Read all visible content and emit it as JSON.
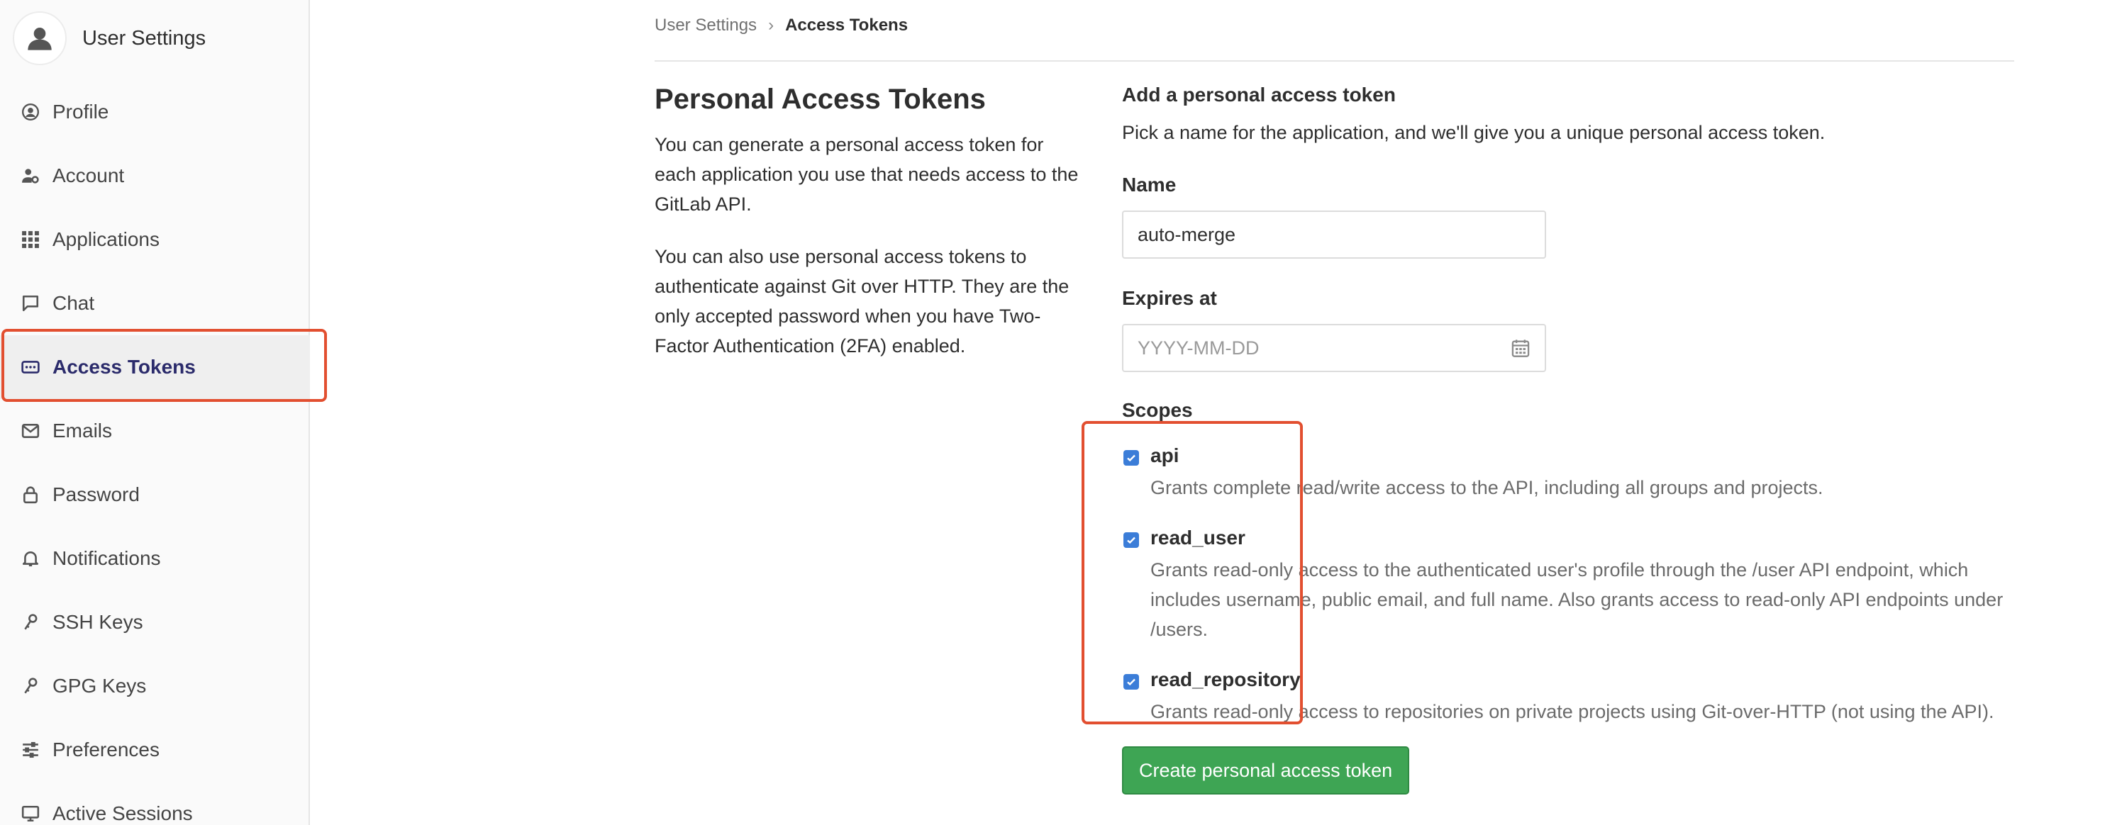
{
  "sidebar": {
    "title": "User Settings",
    "items": [
      {
        "label": "Profile",
        "icon": "user-circle-icon"
      },
      {
        "label": "Account",
        "icon": "account-gear-icon"
      },
      {
        "label": "Applications",
        "icon": "apps-grid-icon"
      },
      {
        "label": "Chat",
        "icon": "chat-bubble-icon"
      },
      {
        "label": "Access Tokens",
        "icon": "token-icon",
        "active": true
      },
      {
        "label": "Emails",
        "icon": "envelope-icon"
      },
      {
        "label": "Password",
        "icon": "lock-icon"
      },
      {
        "label": "Notifications",
        "icon": "bell-icon"
      },
      {
        "label": "SSH Keys",
        "icon": "key-icon"
      },
      {
        "label": "GPG Keys",
        "icon": "key-icon"
      },
      {
        "label": "Preferences",
        "icon": "sliders-icon"
      },
      {
        "label": "Active Sessions",
        "icon": "monitor-icon"
      }
    ]
  },
  "breadcrumb": {
    "parent": "User Settings",
    "separator": "›",
    "current": "Access Tokens"
  },
  "intro": {
    "title": "Personal Access Tokens",
    "p1": "You can generate a personal access token for each application you use that needs access to the GitLab API.",
    "p2": "You can also use personal access tokens to authenticate against Git over HTTP. They are the only accepted password when you have Two-Factor Authentication (2FA) enabled."
  },
  "form": {
    "heading": "Add a personal access token",
    "lead": "Pick a name for the application, and we'll give you a unique personal access token.",
    "name_label": "Name",
    "name_value": "auto-merge",
    "expires_label": "Expires at",
    "expires_placeholder": "YYYY-MM-DD",
    "scopes_label": "Scopes",
    "scopes": [
      {
        "name": "api",
        "checked": true,
        "description": "Grants complete read/write access to the API, including all groups and projects."
      },
      {
        "name": "read_user",
        "checked": true,
        "description": "Grants read-only access to the authenticated user's profile through the /user API endpoint, which includes username, public email, and full name. Also grants access to read-only API endpoints under /users."
      },
      {
        "name": "read_repository",
        "checked": true,
        "description": "Grants read-only access to repositories on private projects using Git-over-HTTP (not using the API)."
      }
    ],
    "submit_label": "Create personal access token"
  },
  "colors": {
    "accent": "#3b7dd8",
    "highlight": "#e24f30",
    "button": "#3ea554",
    "active_text": "#2b2b6b"
  }
}
